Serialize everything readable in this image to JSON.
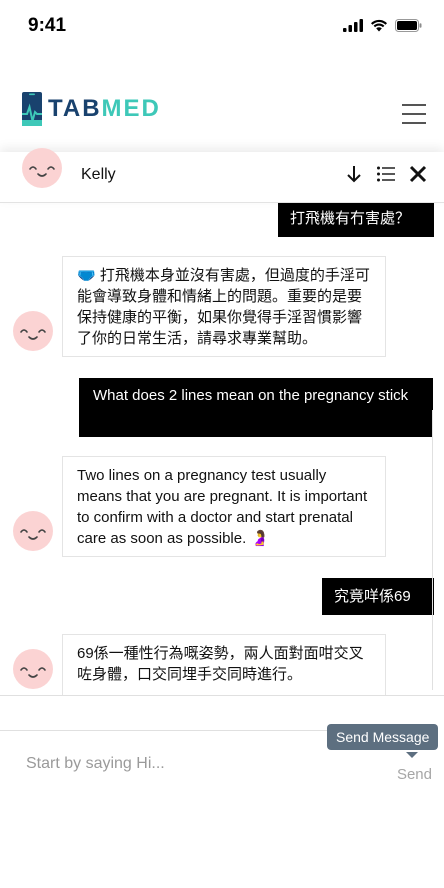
{
  "status_bar": {
    "time": "9:41"
  },
  "app": {
    "logo_tab": "TAB",
    "logo_med": "MED"
  },
  "chat": {
    "agent_name": "Kelly"
  },
  "messages": [
    {
      "role": "user",
      "text": "打飛機有冇害處？"
    },
    {
      "role": "bot",
      "emoji": "🩲",
      "text": "打飛機本身並沒有害處，但過度的手淫可能會導致身體和情緒上的問題。重要的是要保持健康的平衡，如果你覺得手淫習慣影響了你的日常生活，請尋求專業幫助。"
    },
    {
      "role": "user",
      "text": "What does 2 lines mean on the pregnancy stick"
    },
    {
      "role": "bot",
      "text": "Two lines on a pregnancy test usually means that you are pregnant. It is important to confirm with a doctor and start prenatal care as soon as possible.",
      "emoji": "🤰"
    },
    {
      "role": "user",
      "text": "究竟咩係69"
    },
    {
      "role": "bot",
      "text": "69係一種性行為嘅姿勢，兩人面對面咁交叉咗身體，口交同埋手交同時進行。"
    }
  ],
  "input": {
    "placeholder": "Start by saying Hi...",
    "send_label": "Send",
    "tooltip": "Send Message"
  },
  "colors": {
    "brand_dark": "#19426e",
    "brand_teal": "#3ec8b8",
    "user_bubble": "#000000",
    "avatar": "#fbd3d3",
    "tooltip": "#5d6f80"
  }
}
